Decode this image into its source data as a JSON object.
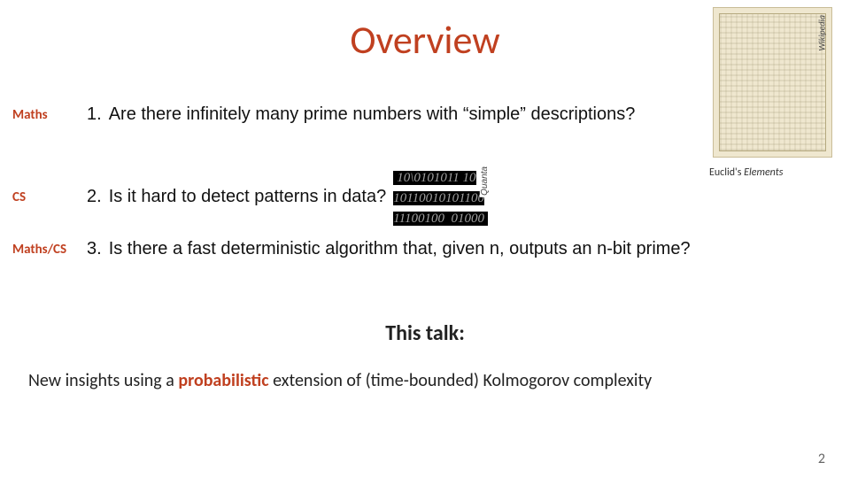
{
  "title": "Overview",
  "image": {
    "source_label": "Wikipedia",
    "caption_prefix": "Euclid's ",
    "caption_book": "Elements"
  },
  "rows": {
    "r1": {
      "tag": "Maths",
      "num": "1.",
      "text": "Are there infinitely many prime numbers with “simple” descriptions?"
    },
    "r2": {
      "tag": "CS",
      "num": "2.",
      "text": "Is it hard to detect patterns in data?",
      "pattern_source": "Quanta",
      "pattern_lines": "10\\0101011 10\n10110010101100\n11100100  01000"
    },
    "r3": {
      "tag": "Maths/CS",
      "num": "3.",
      "text": "Is there a fast deterministic algorithm that, given n, outputs an n-bit prime?"
    }
  },
  "talk": {
    "label": "This talk:",
    "pre": "New insights using a ",
    "emph": "probabilistic",
    "post": " extension of (time-bounded) Kolmogorov complexity"
  },
  "page_number": "2"
}
